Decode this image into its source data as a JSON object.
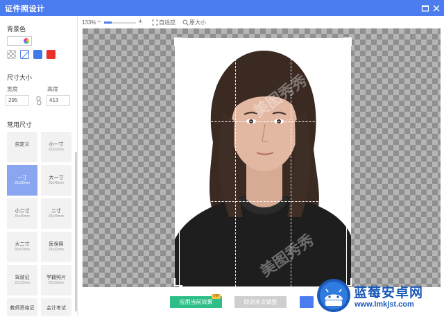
{
  "window": {
    "title": "证件照设计",
    "maximize_icon": "maximize-icon",
    "close_icon": "close-icon"
  },
  "sidebar": {
    "background_label": "背景色",
    "background_swatches": [
      {
        "name": "transparent",
        "color": "checker"
      },
      {
        "name": "white",
        "color": "#FFFFFF",
        "selected": true
      },
      {
        "name": "blue",
        "color": "#3F7BE8"
      },
      {
        "name": "red",
        "color": "#E8312B"
      }
    ],
    "size_label": "尺寸大小",
    "width_label": "宽度",
    "height_label": "高度",
    "width_value": "295",
    "height_value": "413",
    "presets_label": "常用尺寸",
    "presets": [
      {
        "name": "自定义",
        "dims": ""
      },
      {
        "name": "小一寸",
        "dims": "22x32mm"
      },
      {
        "name": "一寸",
        "dims": "25x35mm",
        "active": true
      },
      {
        "name": "大一寸",
        "dims": "33x48mm"
      },
      {
        "name": "小二寸",
        "dims": "35x45mm"
      },
      {
        "name": "二寸",
        "dims": "35x49mm"
      },
      {
        "name": "大二寸",
        "dims": "35x53mm"
      },
      {
        "name": "医保照",
        "dims": "26x32mm"
      },
      {
        "name": "驾驶证",
        "dims": "22x32mm"
      },
      {
        "name": "学籍照片",
        "dims": "26x32mm"
      },
      {
        "name": "教师资格证",
        "dims": ""
      },
      {
        "name": "会计考试",
        "dims": ""
      }
    ]
  },
  "toolbar": {
    "zoom": "133%",
    "fit_label": "自适应",
    "actual_size_label": "原大小"
  },
  "canvas": {
    "watermark": "美图秀秀"
  },
  "footer": {
    "apply_label": "应用当前效果",
    "vip_badge": "VIP",
    "cancel_label": "取消本次调整"
  },
  "branding": {
    "name": "蓝莓安卓网",
    "url": "www.lmkjst.com"
  },
  "colors": {
    "accent": "#4C7DF0",
    "apply": "#2EBE87",
    "brand": "#1C5AB8"
  }
}
